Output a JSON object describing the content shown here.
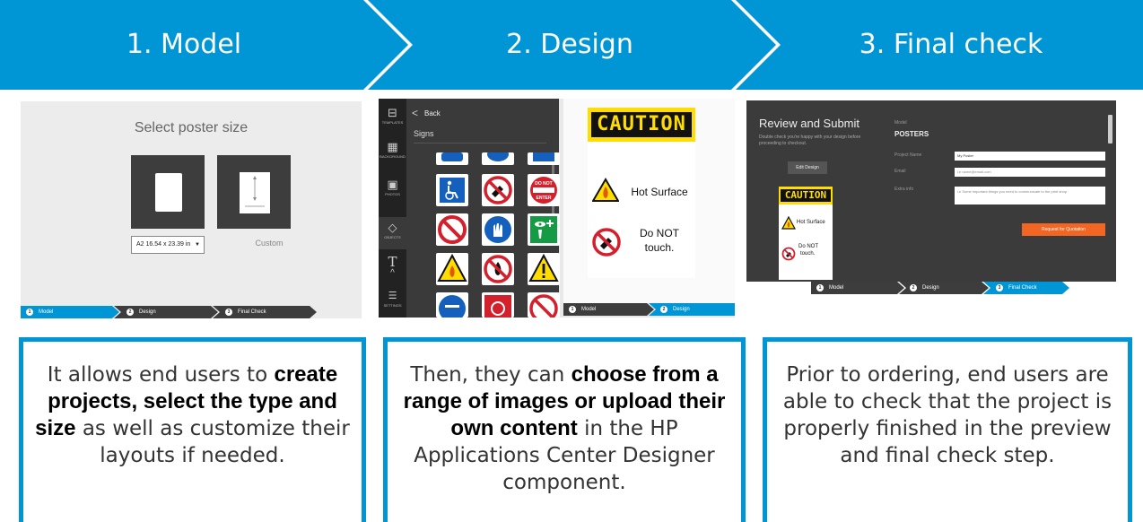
{
  "steps": [
    {
      "label": "1. Model"
    },
    {
      "label": "2. Design"
    },
    {
      "label": "3. Final check"
    }
  ],
  "colors": {
    "accent": "#0096d6",
    "dark_step": "#3d3d3d",
    "caution_yellow": "#ffdd00",
    "orange": "#f26522"
  },
  "panel_model": {
    "title": "Select poster size",
    "size_value": "A2 16.54 x 23.39 in",
    "custom_label": "Custom",
    "mini_steps": [
      {
        "num": "1",
        "label": "Model"
      },
      {
        "num": "2",
        "label": "Design"
      },
      {
        "num": "3",
        "label": "Final Check"
      }
    ]
  },
  "panel_design": {
    "rail": [
      {
        "icon": "templates-icon",
        "label": "TEMPLATES"
      },
      {
        "icon": "background-icon",
        "label": "BACKGROUND"
      },
      {
        "icon": "photos-icon",
        "label": "PHOTOS"
      },
      {
        "icon": "objects-icon",
        "label": "OBJECTS"
      },
      {
        "icon": "text-icon",
        "label": "T"
      },
      {
        "icon": "settings-icon",
        "label": "SETTINGS"
      }
    ],
    "back_label": "Back",
    "category": "Signs",
    "do_not_enter": "DO NOT ENTER",
    "sign": {
      "caution": "CAUTION",
      "hazard_text": "Hot Surface",
      "touch_line1": "Do NOT",
      "touch_line2": "touch."
    },
    "mini_steps": [
      {
        "num": "1",
        "label": "Model"
      },
      {
        "num": "2",
        "label": "Design"
      }
    ]
  },
  "panel_final": {
    "title": "Review and Submit",
    "subtitle": "Double check you're happy with your design before proceeding to checkout.",
    "edit_button": "Edit Design",
    "model_label": "Model",
    "model_value": "POSTERS",
    "project_name_label": "Project Name",
    "project_name_value": "My Poster",
    "email_label": "Email",
    "email_placeholder": "i.e name@email.com",
    "extra_label": "Extra info",
    "extra_placeholder": "i.e Some important things you need to communicate to the print shop",
    "quote_button": "Request for Quotation",
    "sign": {
      "caution": "CAUTION",
      "hazard_text": "Hot Surface",
      "touch_line1": "Do NOT",
      "touch_line2": "touch."
    },
    "mini_steps": [
      {
        "num": "1",
        "label": "Model"
      },
      {
        "num": "2",
        "label": "Design"
      },
      {
        "num": "3",
        "label": "Final Check"
      }
    ]
  },
  "descriptions": [
    {
      "pre": "It allows end users to",
      "em": "create projects, select the type and size",
      "post": "as well as customize their layouts if needed."
    },
    {
      "pre": "Then, they can",
      "em": "choose from a range of images or upload their own content",
      "post": "in the HP Applications Center Designer component."
    },
    {
      "pre": "",
      "em": "",
      "post": "Prior to ordering, end users are able to check that the project is properly finished in the preview and final check step."
    }
  ]
}
